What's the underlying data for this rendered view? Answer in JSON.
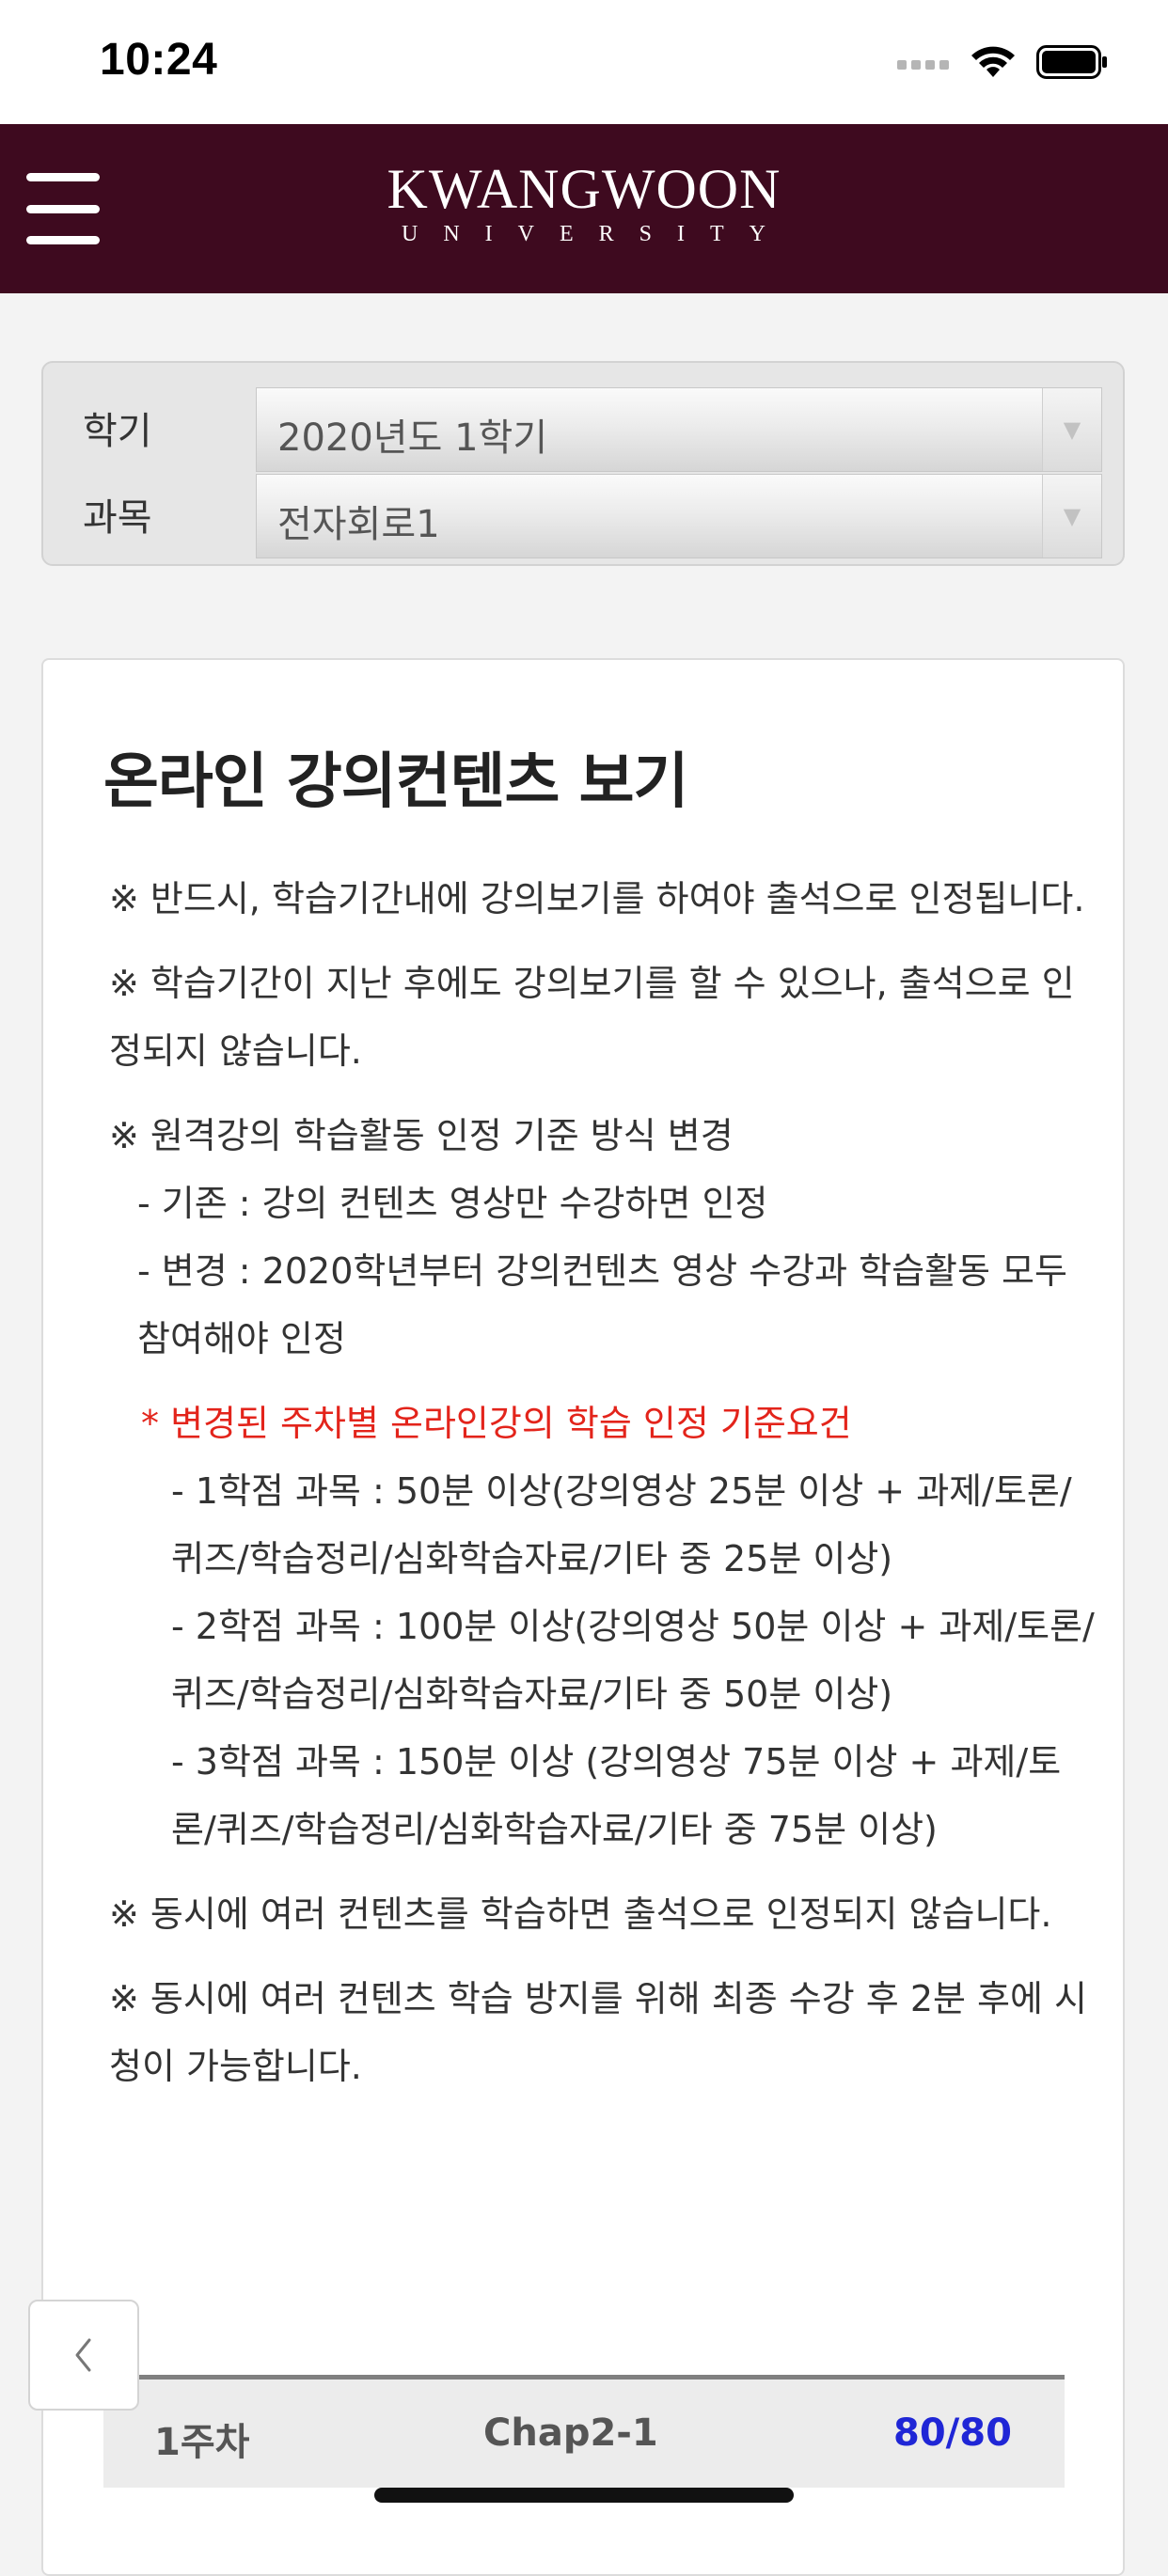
{
  "status_bar": {
    "time": "10:24",
    "icons": [
      "signal-icon",
      "wifi-icon",
      "battery-icon"
    ]
  },
  "header": {
    "logo_main": "KWANGWOON",
    "logo_sub": "UNIVERSITY",
    "brand_color": "#3e0a1f",
    "menu_icon": "hamburger-menu-icon"
  },
  "selectors": {
    "semester_label": "학기",
    "semester_value": "2020년도 1학기",
    "course_label": "과목",
    "course_value": "전자회로1"
  },
  "content": {
    "title": "온라인 강의컨텐츠 보기",
    "notice1": "※ 반드시, 학습기간내에 강의보기를 하여야 출석으로 인정됩니다.",
    "notice2": "※ 학습기간이 지난 후에도 강의보기를 할 수 있으나, 출석으로 인정되지 않습니다.",
    "notice3_title": "※ 원격강의 학습활동 인정 기준 방식 변경",
    "notice3_item1": "- 기존 : 강의 컨텐츠 영상만 수강하면 인정",
    "notice3_item2": "- 변경 : 2020학년부터 강의컨텐츠 영상 수강과 학습활동 모두 참여해야 인정",
    "notice4_title": "* 변경된 주차별 온라인강의 학습 인정 기준요건",
    "notice4_item1": "- 1학점 과목 : 50분 이상(강의영상 25분 이상 + 과제/토론/퀴즈/학습정리/심화학습자료/기타 중 25분 이상)",
    "notice4_item2": "- 2학점 과목 : 100분 이상(강의영상 50분 이상 + 과제/토론/퀴즈/학습정리/심화학습자료/기타 중 50분 이상)",
    "notice4_item3": "- 3학점 과목 : 150분 이상 (강의영상 75분 이상 + 과제/토론/퀴즈/학습정리/심화학습자료/기타 중 75분 이상)",
    "notice5": "※ 동시에 여러 컨텐츠를 학습하면 출석으로 인정되지 않습니다.",
    "notice6": "※ 동시에 여러 컨텐츠 학습 방지를 위해 최종 수강 후 2분 후에 시청이 가능합니다.",
    "highlight_color": "#e3241b"
  },
  "week_table": {
    "week": "1주차",
    "chapter": "Chap2-1",
    "progress": "80/80",
    "progress_color": "#1f26d6"
  },
  "navigation": {
    "back_icon": "chevron-left-icon"
  }
}
